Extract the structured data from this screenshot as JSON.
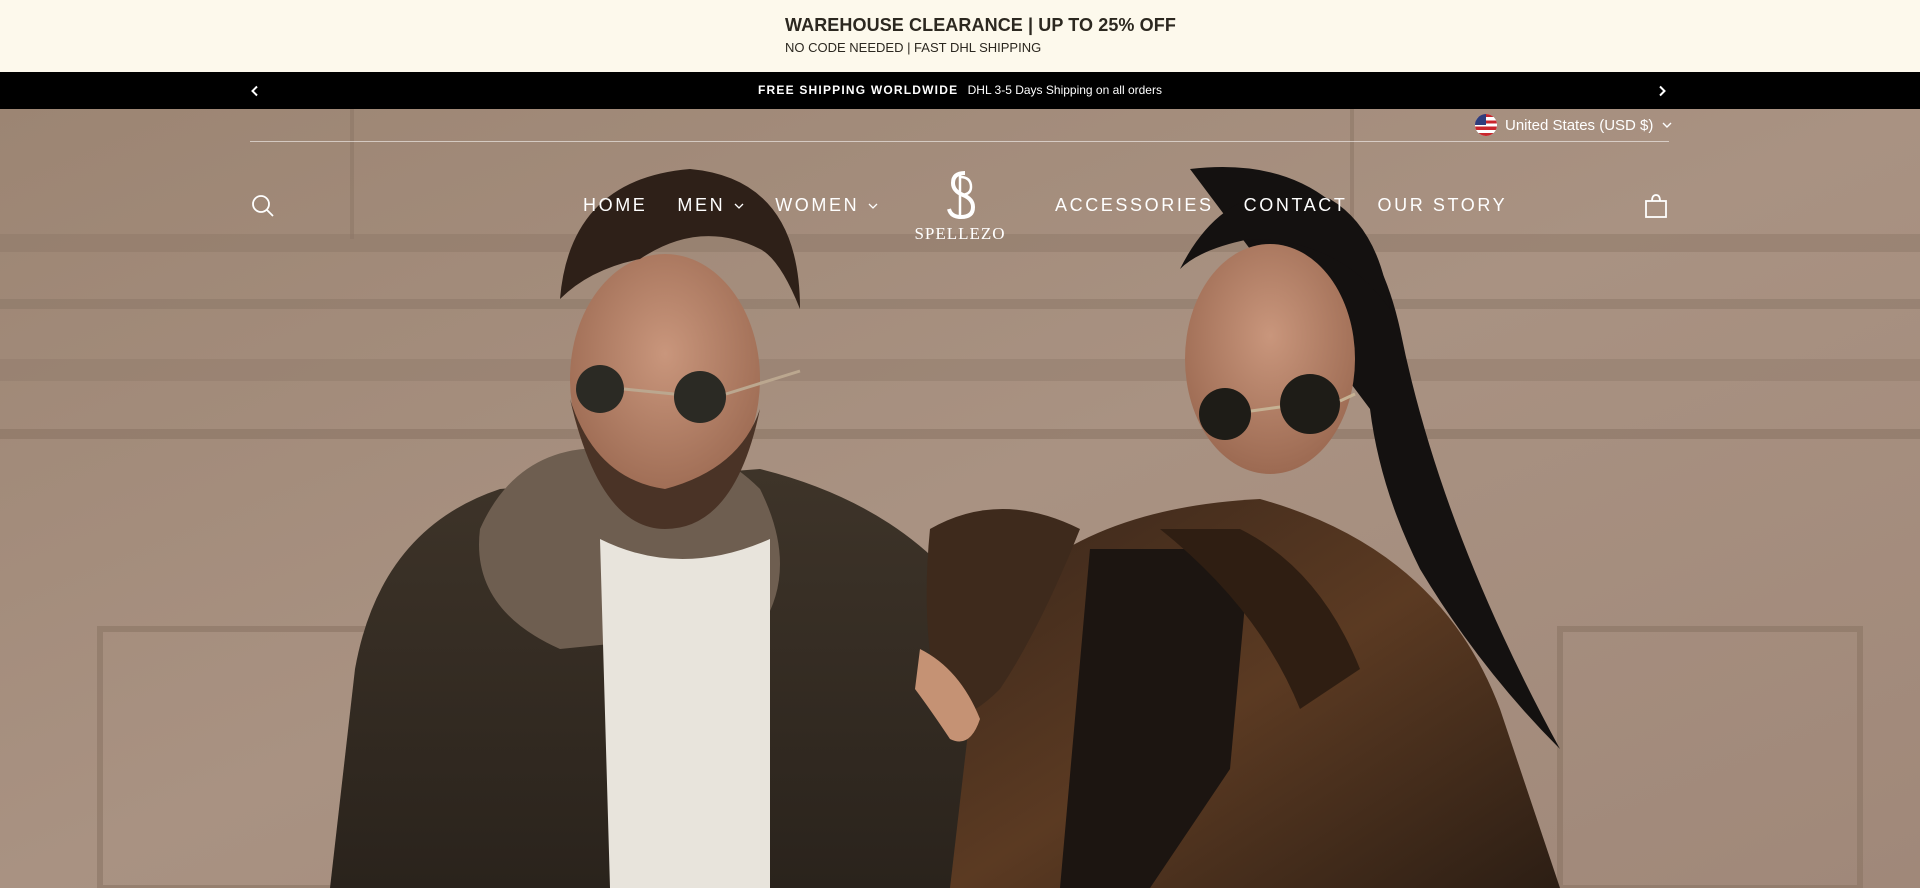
{
  "promo": {
    "title": "WAREHOUSE CLEARANCE | UP TO 25% OFF",
    "subtitle": "NO CODE NEEDED | FAST DHL SHIPPING"
  },
  "announcement": {
    "bold": "FREE SHIPPING WORLDWIDE",
    "text": "DHL 3-5 Days Shipping on all orders",
    "prev_icon": "chevron-left-icon",
    "next_icon": "chevron-right-icon"
  },
  "header": {
    "currency": "United States (USD $)",
    "currency_flag": "us-flag-icon",
    "logo_monogram": "S",
    "logo_text": "SPELLEZO",
    "nav_left": [
      {
        "label": "HOME"
      },
      {
        "label": "MEN"
      },
      {
        "label": "WOMEN"
      }
    ],
    "nav_right": [
      {
        "label": "ACCESSORIES"
      },
      {
        "label": "CONTACT"
      },
      {
        "label": "OUR STORY"
      }
    ],
    "search_icon": "search-icon",
    "cart_icon": "shopping-bag-icon"
  },
  "colors": {
    "promo_bg": "#fdf9ec",
    "announce_bg": "#000000",
    "header_text": "#ffffff"
  }
}
